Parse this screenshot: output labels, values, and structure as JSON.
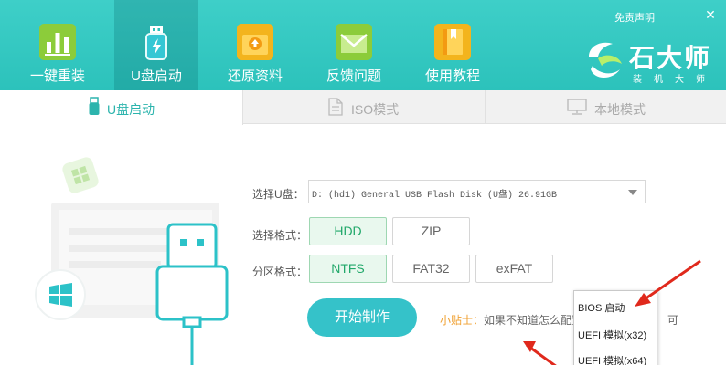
{
  "nav": {
    "items": [
      {
        "label": "一键重装"
      },
      {
        "label": "U盘启动"
      },
      {
        "label": "还原资料"
      },
      {
        "label": "反馈问题"
      },
      {
        "label": "使用教程"
      }
    ],
    "active_index": 1,
    "disclaimer": "免责声明"
  },
  "brand": {
    "name": "石大师",
    "subtitle": "装机大师"
  },
  "tabs": [
    {
      "label": "U盘启动",
      "icon": "usb-drive-icon"
    },
    {
      "label": "ISO模式",
      "icon": "iso-file-icon"
    },
    {
      "label": "本地模式",
      "icon": "monitor-icon"
    }
  ],
  "form": {
    "device_label": "选择U盘：",
    "device_value": "D: (hd1) General USB Flash Disk  (U盘) 26.91GB",
    "format_label": "选择格式：",
    "format_options": [
      "HDD",
      "ZIP"
    ],
    "format_selected": "HDD",
    "partition_label": "分区格式：",
    "partition_options": [
      "NTFS",
      "FAT32",
      "exFAT"
    ],
    "partition_selected": "NTFS",
    "start_button": "开始制作",
    "tip_key": "小贴士：",
    "tip_text": "如果不知道怎么配置",
    "tip_tail": "可"
  },
  "menu": {
    "items": [
      "BIOS 启动",
      "UEFI 模拟(x32)",
      "UEFI 模拟(x64)"
    ]
  },
  "colors": {
    "header": "#2cc2bb",
    "accent": "#35c2c9",
    "selected_green": "#21a86a",
    "arrow_red": "#e0291c"
  }
}
